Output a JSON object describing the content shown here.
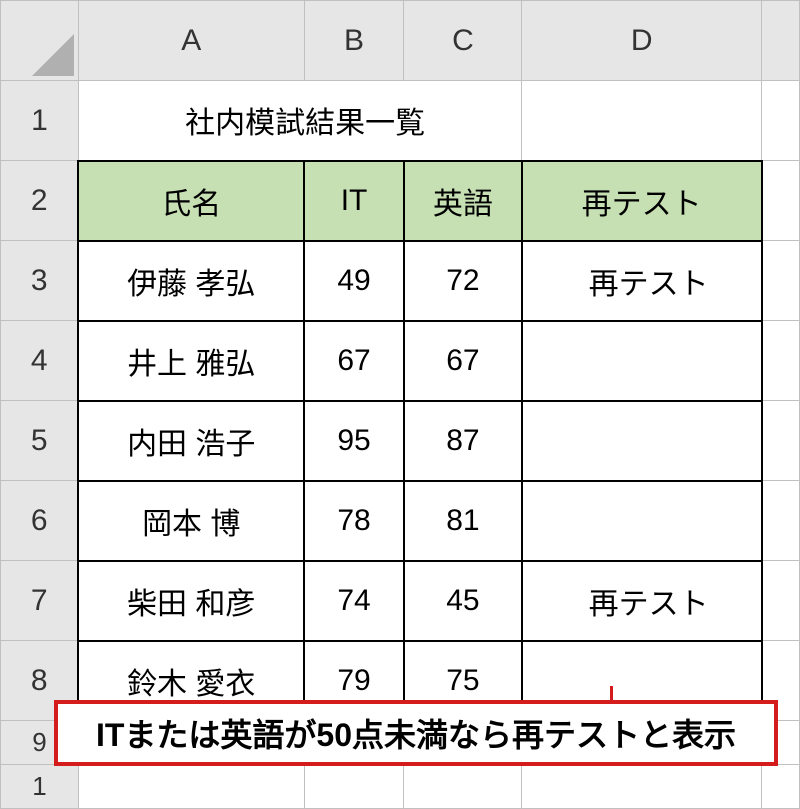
{
  "columns": {
    "A": "A",
    "B": "B",
    "C": "C",
    "D": "D"
  },
  "rownums": [
    "1",
    "2",
    "3",
    "4",
    "5",
    "6",
    "7",
    "8",
    "9",
    "1"
  ],
  "title": "社内模試結果一覧",
  "headers": {
    "name": "氏名",
    "it": "IT",
    "eng": "英語",
    "retest": "再テスト"
  },
  "rows": [
    {
      "name": "伊藤 孝弘",
      "it": "49",
      "eng": "72",
      "retest": "再テスト"
    },
    {
      "name": "井上 雅弘",
      "it": "67",
      "eng": "67",
      "retest": ""
    },
    {
      "name": "内田 浩子",
      "it": "95",
      "eng": "87",
      "retest": ""
    },
    {
      "name": "岡本 博",
      "it": "78",
      "eng": "81",
      "retest": ""
    },
    {
      "name": "柴田 和彦",
      "it": "74",
      "eng": "45",
      "retest": "再テスト"
    },
    {
      "name": "鈴木 愛衣",
      "it": "79",
      "eng": "75",
      "retest": ""
    }
  ],
  "callout": "ITまたは英語が50点未満なら再テストと表示",
  "chart_data": {
    "type": "table",
    "title": "社内模試結果一覧",
    "columns": [
      "氏名",
      "IT",
      "英語",
      "再テスト"
    ],
    "data": [
      [
        "伊藤 孝弘",
        49,
        72,
        "再テスト"
      ],
      [
        "井上 雅弘",
        67,
        67,
        ""
      ],
      [
        "内田 浩子",
        95,
        87,
        ""
      ],
      [
        "岡本 博",
        78,
        81,
        ""
      ],
      [
        "柴田 和彦",
        74,
        45,
        "再テスト"
      ],
      [
        "鈴木 愛衣",
        79,
        75,
        ""
      ]
    ],
    "note": "ITまたは英語が50点未満なら再テストと表示"
  }
}
